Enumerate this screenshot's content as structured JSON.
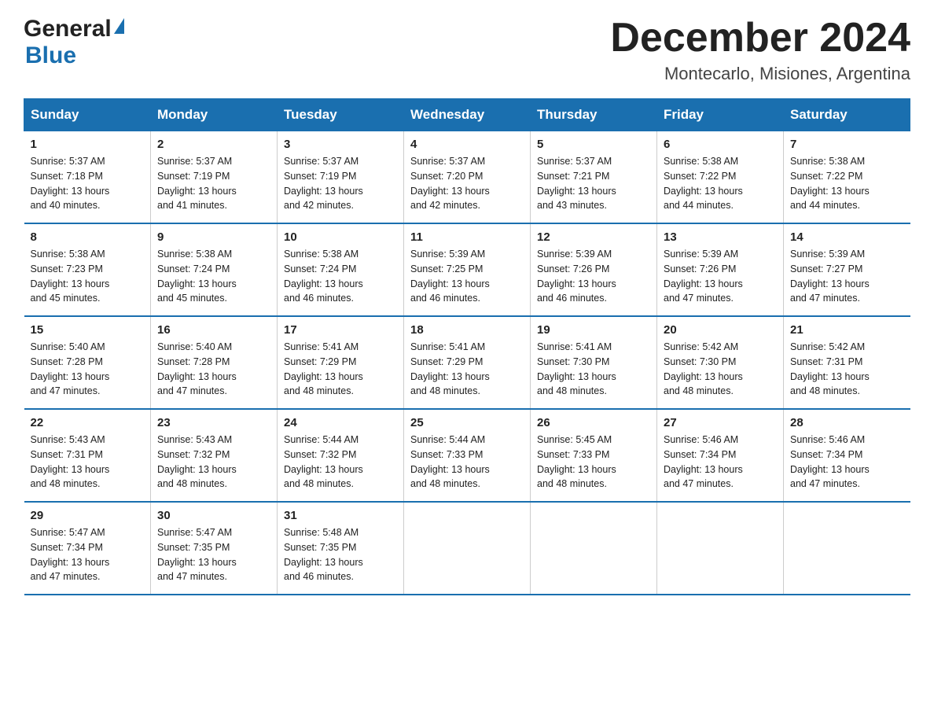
{
  "header": {
    "logo_general": "General",
    "logo_blue": "Blue",
    "month_title": "December 2024",
    "location": "Montecarlo, Misiones, Argentina"
  },
  "days_of_week": [
    "Sunday",
    "Monday",
    "Tuesday",
    "Wednesday",
    "Thursday",
    "Friday",
    "Saturday"
  ],
  "weeks": [
    [
      {
        "day": "1",
        "sunrise": "5:37 AM",
        "sunset": "7:18 PM",
        "daylight": "13 hours and 40 minutes."
      },
      {
        "day": "2",
        "sunrise": "5:37 AM",
        "sunset": "7:19 PM",
        "daylight": "13 hours and 41 minutes."
      },
      {
        "day": "3",
        "sunrise": "5:37 AM",
        "sunset": "7:19 PM",
        "daylight": "13 hours and 42 minutes."
      },
      {
        "day": "4",
        "sunrise": "5:37 AM",
        "sunset": "7:20 PM",
        "daylight": "13 hours and 42 minutes."
      },
      {
        "day": "5",
        "sunrise": "5:37 AM",
        "sunset": "7:21 PM",
        "daylight": "13 hours and 43 minutes."
      },
      {
        "day": "6",
        "sunrise": "5:38 AM",
        "sunset": "7:22 PM",
        "daylight": "13 hours and 44 minutes."
      },
      {
        "day": "7",
        "sunrise": "5:38 AM",
        "sunset": "7:22 PM",
        "daylight": "13 hours and 44 minutes."
      }
    ],
    [
      {
        "day": "8",
        "sunrise": "5:38 AM",
        "sunset": "7:23 PM",
        "daylight": "13 hours and 45 minutes."
      },
      {
        "day": "9",
        "sunrise": "5:38 AM",
        "sunset": "7:24 PM",
        "daylight": "13 hours and 45 minutes."
      },
      {
        "day": "10",
        "sunrise": "5:38 AM",
        "sunset": "7:24 PM",
        "daylight": "13 hours and 46 minutes."
      },
      {
        "day": "11",
        "sunrise": "5:39 AM",
        "sunset": "7:25 PM",
        "daylight": "13 hours and 46 minutes."
      },
      {
        "day": "12",
        "sunrise": "5:39 AM",
        "sunset": "7:26 PM",
        "daylight": "13 hours and 46 minutes."
      },
      {
        "day": "13",
        "sunrise": "5:39 AM",
        "sunset": "7:26 PM",
        "daylight": "13 hours and 47 minutes."
      },
      {
        "day": "14",
        "sunrise": "5:39 AM",
        "sunset": "7:27 PM",
        "daylight": "13 hours and 47 minutes."
      }
    ],
    [
      {
        "day": "15",
        "sunrise": "5:40 AM",
        "sunset": "7:28 PM",
        "daylight": "13 hours and 47 minutes."
      },
      {
        "day": "16",
        "sunrise": "5:40 AM",
        "sunset": "7:28 PM",
        "daylight": "13 hours and 47 minutes."
      },
      {
        "day": "17",
        "sunrise": "5:41 AM",
        "sunset": "7:29 PM",
        "daylight": "13 hours and 48 minutes."
      },
      {
        "day": "18",
        "sunrise": "5:41 AM",
        "sunset": "7:29 PM",
        "daylight": "13 hours and 48 minutes."
      },
      {
        "day": "19",
        "sunrise": "5:41 AM",
        "sunset": "7:30 PM",
        "daylight": "13 hours and 48 minutes."
      },
      {
        "day": "20",
        "sunrise": "5:42 AM",
        "sunset": "7:30 PM",
        "daylight": "13 hours and 48 minutes."
      },
      {
        "day": "21",
        "sunrise": "5:42 AM",
        "sunset": "7:31 PM",
        "daylight": "13 hours and 48 minutes."
      }
    ],
    [
      {
        "day": "22",
        "sunrise": "5:43 AM",
        "sunset": "7:31 PM",
        "daylight": "13 hours and 48 minutes."
      },
      {
        "day": "23",
        "sunrise": "5:43 AM",
        "sunset": "7:32 PM",
        "daylight": "13 hours and 48 minutes."
      },
      {
        "day": "24",
        "sunrise": "5:44 AM",
        "sunset": "7:32 PM",
        "daylight": "13 hours and 48 minutes."
      },
      {
        "day": "25",
        "sunrise": "5:44 AM",
        "sunset": "7:33 PM",
        "daylight": "13 hours and 48 minutes."
      },
      {
        "day": "26",
        "sunrise": "5:45 AM",
        "sunset": "7:33 PM",
        "daylight": "13 hours and 48 minutes."
      },
      {
        "day": "27",
        "sunrise": "5:46 AM",
        "sunset": "7:34 PM",
        "daylight": "13 hours and 47 minutes."
      },
      {
        "day": "28",
        "sunrise": "5:46 AM",
        "sunset": "7:34 PM",
        "daylight": "13 hours and 47 minutes."
      }
    ],
    [
      {
        "day": "29",
        "sunrise": "5:47 AM",
        "sunset": "7:34 PM",
        "daylight": "13 hours and 47 minutes."
      },
      {
        "day": "30",
        "sunrise": "5:47 AM",
        "sunset": "7:35 PM",
        "daylight": "13 hours and 47 minutes."
      },
      {
        "day": "31",
        "sunrise": "5:48 AM",
        "sunset": "7:35 PM",
        "daylight": "13 hours and 46 minutes."
      },
      null,
      null,
      null,
      null
    ]
  ]
}
